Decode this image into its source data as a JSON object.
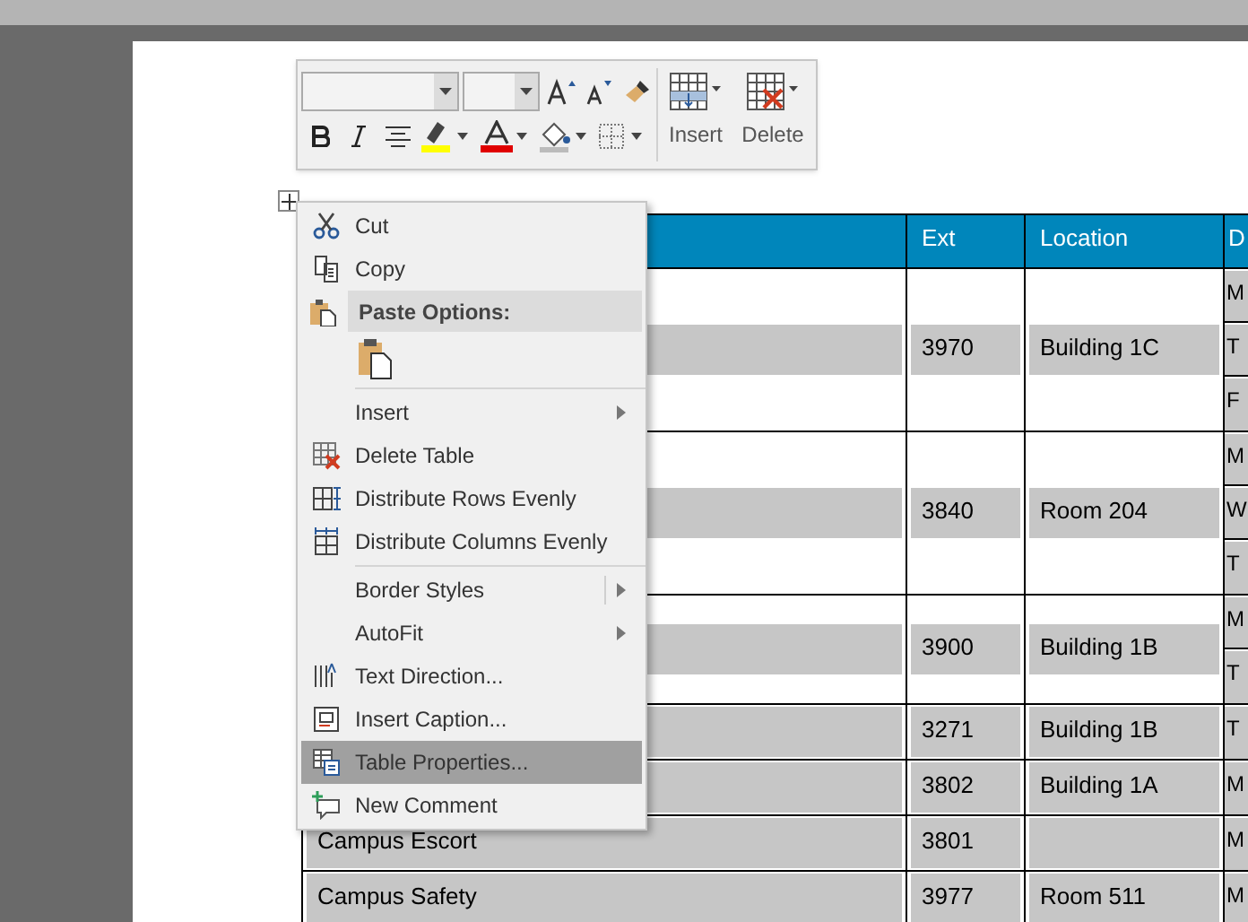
{
  "table": {
    "header": {
      "column_2": "Ext",
      "column_3": "Location",
      "column_4": "D"
    },
    "rows": [
      {
        "ext": "3970",
        "location": "Building 1C",
        "column_4": [
          "M",
          "T",
          "F"
        ]
      },
      {
        "ext": "3840",
        "location": "Room 204",
        "column_4": [
          "M",
          "W",
          "T"
        ]
      },
      {
        "ext": "3900",
        "location": "Building 1B",
        "column_4": [
          "M",
          "T"
        ]
      },
      {
        "ext": "3271",
        "location": "Building 1B",
        "column_4": [
          "T"
        ]
      },
      {
        "ext": "3802",
        "location": "Building 1A",
        "column_4": [
          "M"
        ]
      },
      {
        "name": "Campus Escort",
        "ext": "3801",
        "column_4": [
          "M"
        ]
      },
      {
        "name": "Campus Safety",
        "ext": "3977",
        "location": "Room 511",
        "column_4": [
          "M"
        ]
      }
    ]
  },
  "mini_toolbar": {
    "insert_label": "Insert",
    "delete_label": "Delete"
  },
  "context_menu": [
    {
      "kind": "command",
      "label": "Cut",
      "selected": false
    },
    {
      "kind": "command",
      "label": "Copy",
      "selected": false
    },
    {
      "kind": "header",
      "label": "Paste Options:"
    },
    {
      "kind": "paste"
    },
    {
      "kind": "separator"
    },
    {
      "kind": "submenu",
      "label": "Insert",
      "selected": false
    },
    {
      "kind": "command",
      "label": "Delete Table",
      "selected": false
    },
    {
      "kind": "command",
      "label": "Distribute Rows Evenly",
      "selected": false
    },
    {
      "kind": "command",
      "label": "Distribute Columns Evenly",
      "selected": false
    },
    {
      "kind": "separator"
    },
    {
      "kind": "split",
      "label": "Border Styles",
      "selected": false
    },
    {
      "kind": "submenu",
      "label": "AutoFit",
      "selected": false
    },
    {
      "kind": "command",
      "label": "Text Direction...",
      "selected": false
    },
    {
      "kind": "command",
      "label": "Insert Caption...",
      "selected": false
    },
    {
      "kind": "command",
      "label": "Table Properties...",
      "selected": true
    },
    {
      "kind": "command",
      "label": "New Comment",
      "selected": false
    }
  ]
}
